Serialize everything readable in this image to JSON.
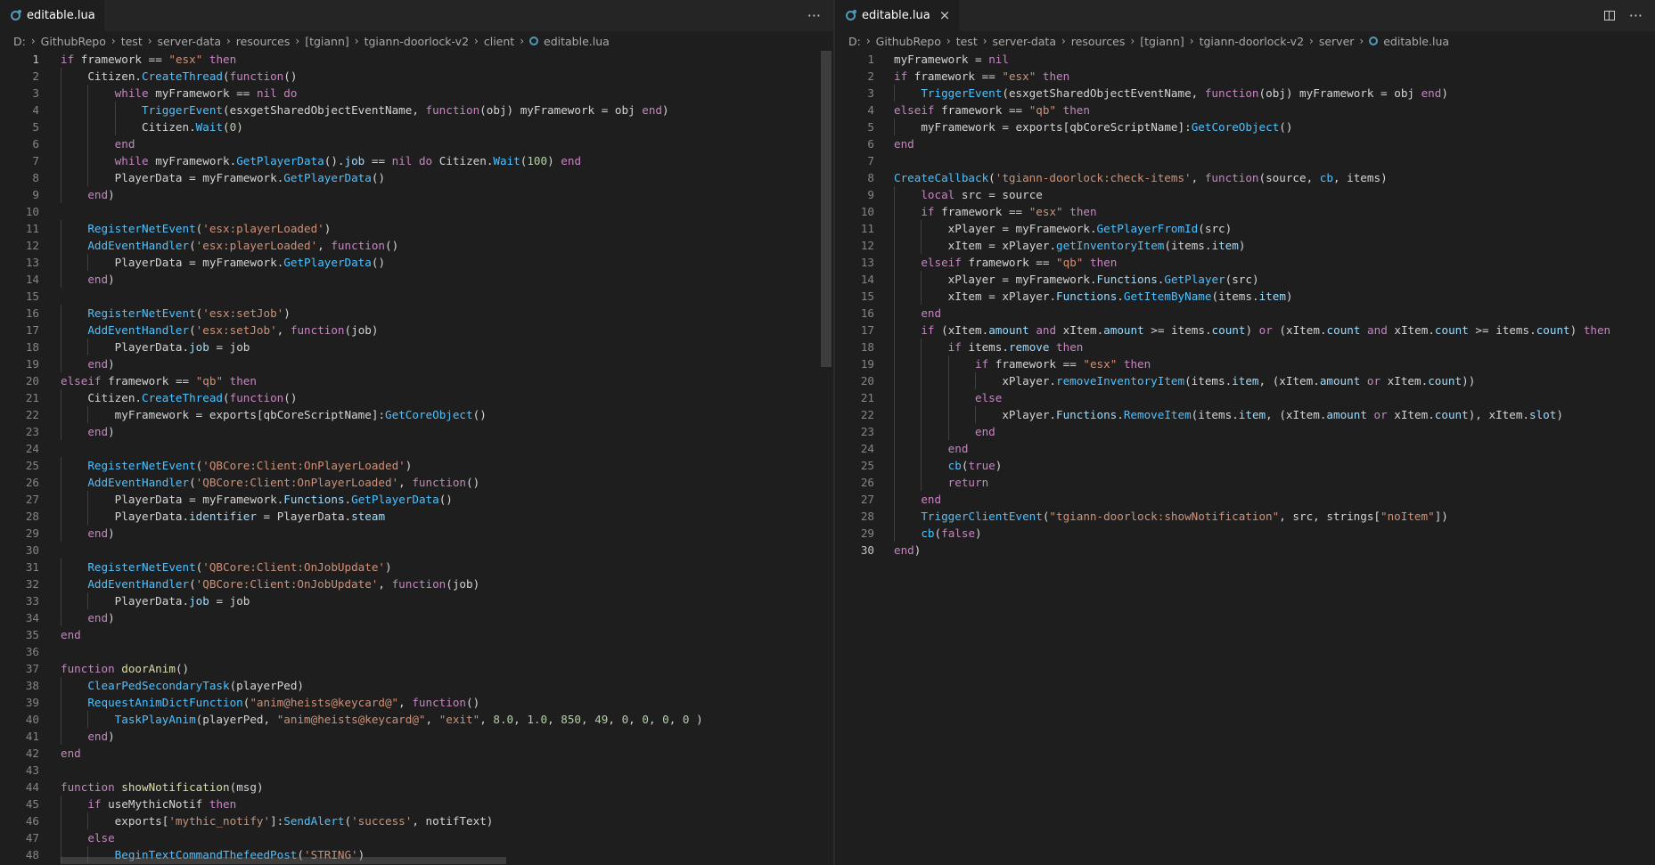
{
  "left": {
    "tab": {
      "label": "editable.lua",
      "close": "×"
    },
    "more_actions": "···",
    "breadcrumb": [
      "D:",
      "GithubRepo",
      "test",
      "server-data",
      "resources",
      "[tgiann]",
      "tgiann-doorlock-v2",
      "client",
      "editable.lua"
    ],
    "lines": [
      "if framework == \"esx\" then",
      "    Citizen.CreateThread(function()",
      "        while myFramework == nil do",
      "            TriggerEvent(esxgetSharedObjectEventName, function(obj) myFramework = obj end)",
      "            Citizen.Wait(0)",
      "        end",
      "        while myFramework.GetPlayerData().job == nil do Citizen.Wait(100) end",
      "        PlayerData = myFramework.GetPlayerData()",
      "    end)",
      "",
      "    RegisterNetEvent('esx:playerLoaded')",
      "    AddEventHandler('esx:playerLoaded', function()",
      "        PlayerData = myFramework.GetPlayerData()",
      "    end)",
      "",
      "    RegisterNetEvent('esx:setJob')",
      "    AddEventHandler('esx:setJob', function(job)",
      "        PlayerData.job = job",
      "    end)",
      "elseif framework == \"qb\" then",
      "    Citizen.CreateThread(function()",
      "        myFramework = exports[qbCoreScriptName]:GetCoreObject()",
      "    end)",
      "",
      "    RegisterNetEvent('QBCore:Client:OnPlayerLoaded')",
      "    AddEventHandler('QBCore:Client:OnPlayerLoaded', function()",
      "        PlayerData = myFramework.Functions.GetPlayerData()",
      "        PlayerData.identifier = PlayerData.steam",
      "    end)",
      "",
      "    RegisterNetEvent('QBCore:Client:OnJobUpdate')",
      "    AddEventHandler('QBCore:Client:OnJobUpdate', function(job)",
      "        PlayerData.job = job",
      "    end)",
      "end",
      "",
      "function doorAnim()",
      "    ClearPedSecondaryTask(playerPed)",
      "    RequestAnimDictFunction(\"anim@heists@keycard@\", function()",
      "        TaskPlayAnim(playerPed, \"anim@heists@keycard@\", \"exit\", 8.0, 1.0, 850, 49, 0, 0, 0, 0 )",
      "    end)",
      "end",
      "",
      "function showNotification(msg)",
      "    if useMythicNotif then",
      "        exports['mythic_notify']:SendAlert('success', notifText)",
      "    else",
      "        BeginTextCommandThefeedPost('STRING')"
    ]
  },
  "right": {
    "tab": {
      "label": "editable.lua",
      "close": "×"
    },
    "more_actions": "···",
    "breadcrumb": [
      "D:",
      "GithubRepo",
      "test",
      "server-data",
      "resources",
      "[tgiann]",
      "tgiann-doorlock-v2",
      "server",
      "editable.lua"
    ],
    "lines": [
      "myFramework = nil",
      "if framework == \"esx\" then",
      "    TriggerEvent(esxgetSharedObjectEventName, function(obj) myFramework = obj end)",
      "elseif framework == \"qb\" then",
      "    myFramework = exports[qbCoreScriptName]:GetCoreObject()",
      "end",
      "",
      "CreateCallback('tgiann-doorlock:check-items', function(source, cb, items)",
      "    local src = source",
      "    if framework == \"esx\" then",
      "        xPlayer = myFramework.GetPlayerFromId(src)",
      "        xItem = xPlayer.getInventoryItem(items.item)",
      "    elseif framework == \"qb\" then",
      "        xPlayer = myFramework.Functions.GetPlayer(src)",
      "        xItem = xPlayer.Functions.GetItemByName(items.item)",
      "    end",
      "    if (xItem.amount and xItem.amount >= items.count) or (xItem.count and xItem.count >= items.count) then",
      "        if items.remove then",
      "            if framework == \"esx\" then",
      "                xPlayer.removeInventoryItem(items.item, (xItem.amount or xItem.count))",
      "            else",
      "                xPlayer.Functions.RemoveItem(items.item, (xItem.amount or xItem.count), xItem.slot)",
      "            end",
      "        end",
      "        cb(true)",
      "        return",
      "    end",
      "    TriggerClientEvent(\"tgiann-doorlock:showNotification\", src, strings[\"noItem\"])",
      "    cb(false)",
      "end)"
    ]
  },
  "theme": {
    "background": "#1e1e1e",
    "keyword": "#c586c0",
    "function": "#4fc1ff",
    "string": "#ce9178",
    "number": "#b5cea8",
    "property": "#9cdcfe"
  },
  "icons": {
    "file": "lua-file-icon",
    "split": "split-editor-icon",
    "more": "more-actions-icon",
    "close": "close-icon"
  }
}
